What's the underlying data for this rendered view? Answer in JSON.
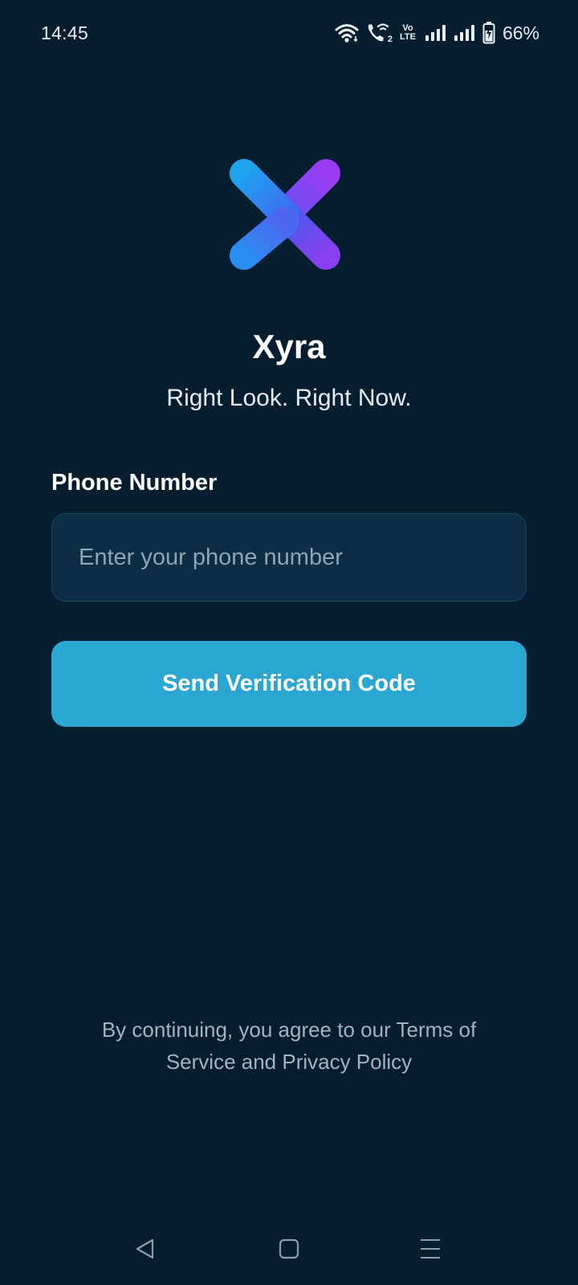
{
  "status_bar": {
    "time": "14:45",
    "battery_percent": "66%",
    "icons": [
      "wifi-icon",
      "wifi-calling-icon",
      "volte-icon",
      "signal-sim1-icon",
      "signal-sim2-icon",
      "battery-charging-icon"
    ],
    "volte_text_top": "Vo",
    "volte_text_bottom": "LTE",
    "wifi_call_badge": "2"
  },
  "app": {
    "name": "Xyra",
    "tagline": "Right Look. Right Now.",
    "logo_icon": "x-logo-icon",
    "logo_colors": {
      "start": "#1fa3f0",
      "end": "#8a3ff0"
    }
  },
  "form": {
    "phone_label": "Phone Number",
    "phone_value": "",
    "phone_placeholder": "Enter your phone number",
    "send_button_label": "Send Verification Code"
  },
  "footer": {
    "terms_text": "By continuing, you agree to our Terms of Service and Privacy Policy"
  },
  "nav_bar": {
    "icons": [
      "back-triangle-icon",
      "home-square-icon",
      "menu-lines-icon"
    ]
  },
  "colors": {
    "background": "#041e30",
    "input_background": "#0b2d45",
    "button": "#29a7d2",
    "muted_text": "#a3b2bf"
  }
}
